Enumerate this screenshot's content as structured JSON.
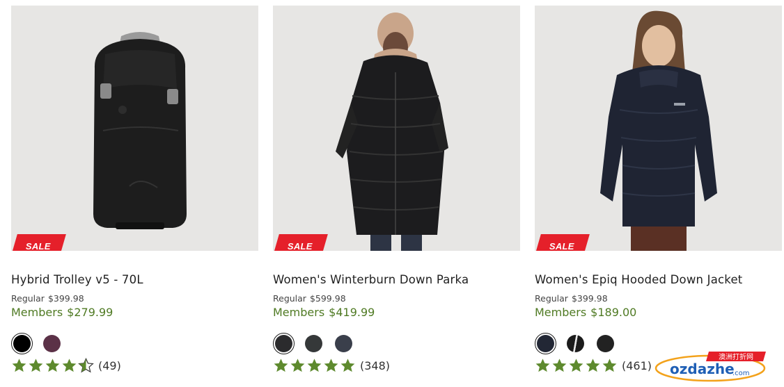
{
  "products": [
    {
      "name": "Hybrid Trolley v5 - 70L",
      "badge": "SALE",
      "regular_label": "Regular",
      "regular_price": "$399.98",
      "members_label": "Members",
      "members_price": "$279.99",
      "image_icon": "trolley-bag-image",
      "swatches": [
        {
          "color": "#000000",
          "selected": true
        },
        {
          "color": "#5b3147",
          "selected": false
        }
      ],
      "rating_value": 4.5,
      "review_count": "(49)"
    },
    {
      "name": "Women's Winterburn Down Parka",
      "badge": "SALE",
      "regular_label": "Regular",
      "regular_price": "$599.98",
      "members_label": "Members",
      "members_price": "$419.99",
      "image_icon": "down-parka-image",
      "swatches": [
        {
          "color": "#2b2b2d",
          "selected": true
        },
        {
          "color": "#353839",
          "selected": false
        },
        {
          "color": "#3a3f4b",
          "selected": false
        }
      ],
      "rating_value": 5,
      "review_count": "(348)"
    },
    {
      "name": "Women's Epiq Hooded Down Jacket",
      "badge": "SALE",
      "regular_label": "Regular",
      "regular_price": "$399.98",
      "members_label": "Members",
      "members_price": "$189.00",
      "image_icon": "hooded-down-jacket-image",
      "swatches": [
        {
          "color": "#222735",
          "selected": true
        },
        {
          "color": "#1b1b1b",
          "selected": false,
          "pattern": "split"
        },
        {
          "color": "#222222",
          "selected": false
        }
      ],
      "rating_value": 5,
      "review_count": "(461)"
    }
  ],
  "colors": {
    "sale_red": "#e5202a",
    "member_green": "#4f7a23",
    "star_green": "#5e8a2e",
    "image_bg": "#e7e6e4"
  },
  "watermark": {
    "brand": "ozdazhe",
    "suffix": ".com",
    "tag": "澳洲打折网"
  }
}
